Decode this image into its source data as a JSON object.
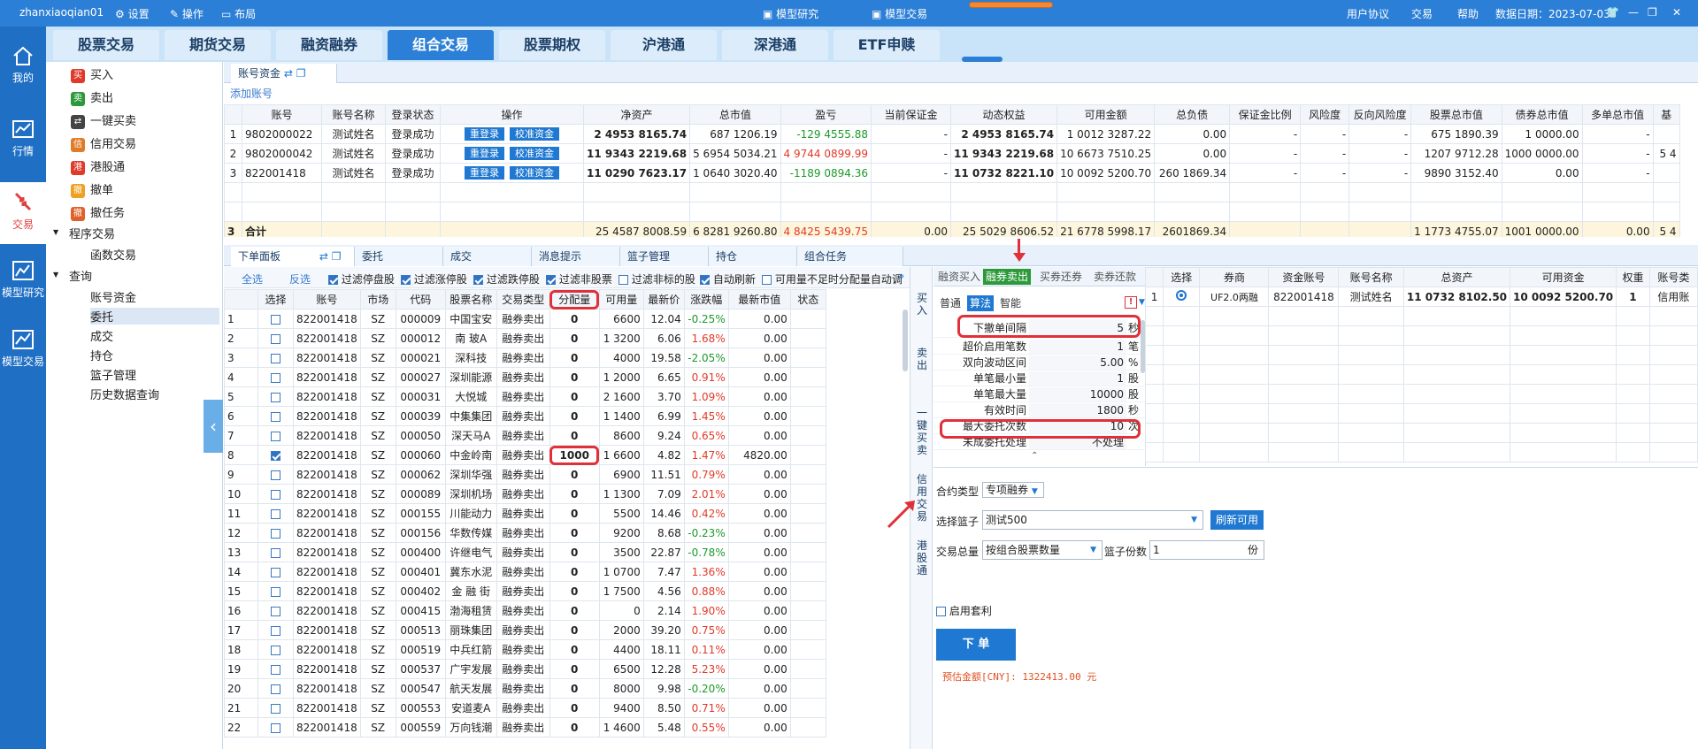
{
  "titlebar": {
    "user": "zhanxiaoqian01",
    "settings": "设置",
    "operation": "操作",
    "layout": "布局",
    "model_research": "模型研究",
    "model_trading": "模型交易",
    "agreement": "用户协议",
    "trade": "交易",
    "help": "帮助",
    "data_date": "数据日期：2023-07-03"
  },
  "leftnav": [
    {
      "label": "我的",
      "icon": "home-icon"
    },
    {
      "label": "行情",
      "icon": "chart-icon"
    },
    {
      "label": "交易",
      "icon": "trade-icon"
    },
    {
      "label": "模型研究",
      "icon": "model-research-icon"
    },
    {
      "label": "模型交易",
      "icon": "model-trade-icon"
    }
  ],
  "tabs": [
    "股票交易",
    "期货交易",
    "融资融券",
    "组合交易",
    "股票期权",
    "沪港通",
    "深港通",
    "ETF申赎"
  ],
  "tree": {
    "items": [
      {
        "icon": "买",
        "label": "买入",
        "color": "#e03a2a"
      },
      {
        "icon": "卖",
        "label": "卖出",
        "color": "#2c9a3a"
      },
      {
        "icon": "⇄",
        "label": "一键买卖",
        "color": "#444"
      },
      {
        "icon": "信",
        "label": "信用交易",
        "color": "#e07b2a"
      },
      {
        "icon": "港",
        "label": "港股通",
        "color": "#e03a2a"
      },
      {
        "icon": "撤",
        "label": "撤单",
        "color": "#f0a020"
      },
      {
        "icon": "撤",
        "label": "撤任务",
        "color": "#e0602a"
      }
    ],
    "program": "程序交易",
    "function_trade": "函数交易",
    "query": "查询",
    "query_items": [
      "账号资金",
      "委托",
      "成交",
      "持仓",
      "篮子管理",
      "历史数据查询"
    ]
  },
  "account": {
    "tab": "账号资金",
    "add": "添加账号",
    "headers": [
      "",
      "账号",
      "账号名称",
      "登录状态",
      "操作",
      "净资产",
      "总市值",
      "盈亏",
      "当前保证金",
      "动态权益",
      "可用金额",
      "总负债",
      "保证金比例",
      "风险度",
      "反向风险度",
      "股票总市值",
      "债券总市值",
      "多单总市值",
      "基"
    ],
    "relogin": "重登录",
    "verify": "校准资金",
    "rows": [
      [
        "1",
        "9802000022",
        "测试姓名",
        "登录成功",
        "",
        "2 4953 8165.74",
        "687 1206.19",
        "-129 4555.88",
        "-",
        "2 4953 8165.74",
        "1 0012 3287.22",
        "0.00",
        "-",
        "-",
        "-",
        "675 1890.39",
        "1 0000.00",
        "-",
        ""
      ],
      [
        "2",
        "9802000042",
        "测试姓名",
        "登录成功",
        "",
        "11 9343 2219.68",
        "5 6954 5034.21",
        "4 9744 0899.99",
        "-",
        "11 9343 2219.68",
        "10 6673 7510.25",
        "0.00",
        "-",
        "-",
        "-",
        "1207 9712.28",
        "1000 0000.00",
        "-",
        "5 4"
      ],
      [
        "3",
        "822001418",
        "测试姓名",
        "登录成功",
        "",
        "11 0290 7623.17",
        "1 0640 3020.40",
        "-1189 0894.36",
        "-",
        "11 0732 8221.10",
        "10 0092 5200.70",
        "260 1869.34",
        "-",
        "-",
        "-",
        "9890 3152.40",
        "0.00",
        "-",
        ""
      ]
    ],
    "total": [
      "3",
      "合计",
      "",
      "",
      "",
      "25 4587 8008.59",
      "6 8281 9260.80",
      "4 8425 5439.75",
      "0.00",
      "25 5029 8606.52",
      "21 6778 5998.17",
      "2601869.34",
      "",
      "",
      "",
      "1 1773 4755.07",
      "1001 0000.00",
      "0.00",
      "5 4"
    ]
  },
  "order_tabs": [
    "下单面板",
    "委托",
    "成交",
    "消息提示",
    "篮子管理",
    "持仓",
    "组合任务"
  ],
  "filters": {
    "select_all": "全选",
    "invert": "反选",
    "opts": [
      {
        "label": "过滤停盘股",
        "on": true
      },
      {
        "label": "过滤涨停股",
        "on": true
      },
      {
        "label": "过滤跌停股",
        "on": true
      },
      {
        "label": "过滤非股票",
        "on": true
      },
      {
        "label": "过滤非标的股",
        "on": false
      },
      {
        "label": "自动刷新",
        "on": true
      },
      {
        "label": "可用量不足时分配量自动调",
        "on": false
      }
    ]
  },
  "stock_table": {
    "headers": [
      "",
      "选择",
      "账号",
      "市场",
      "代码",
      "股票名称",
      "交易类型",
      "分配量",
      "可用量",
      "最新价",
      "涨跌幅",
      "最新市值",
      "状态"
    ],
    "rows": [
      [
        "1",
        false,
        "822001418",
        "SZ",
        "000009",
        "中国宝安",
        "融券卖出",
        "0",
        "6600",
        "12.04",
        "-0.25%",
        "0.00"
      ],
      [
        "2",
        false,
        "822001418",
        "SZ",
        "000012",
        "南 玻A",
        "融券卖出",
        "0",
        "1 3200",
        "6.06",
        "1.68%",
        "0.00"
      ],
      [
        "3",
        false,
        "822001418",
        "SZ",
        "000021",
        "深科技",
        "融券卖出",
        "0",
        "4000",
        "19.58",
        "-2.05%",
        "0.00"
      ],
      [
        "4",
        false,
        "822001418",
        "SZ",
        "000027",
        "深圳能源",
        "融券卖出",
        "0",
        "1 2000",
        "6.65",
        "0.91%",
        "0.00"
      ],
      [
        "5",
        false,
        "822001418",
        "SZ",
        "000031",
        "大悦城",
        "融券卖出",
        "0",
        "2 1600",
        "3.70",
        "1.09%",
        "0.00"
      ],
      [
        "6",
        false,
        "822001418",
        "SZ",
        "000039",
        "中集集团",
        "融券卖出",
        "0",
        "1 1400",
        "6.99",
        "1.45%",
        "0.00"
      ],
      [
        "7",
        false,
        "822001418",
        "SZ",
        "000050",
        "深天马A",
        "融券卖出",
        "0",
        "8600",
        "9.24",
        "0.65%",
        "0.00"
      ],
      [
        "8",
        true,
        "822001418",
        "SZ",
        "000060",
        "中金岭南",
        "融券卖出",
        "1000",
        "1 6600",
        "4.82",
        "1.47%",
        "4820.00"
      ],
      [
        "9",
        false,
        "822001418",
        "SZ",
        "000062",
        "深圳华强",
        "融券卖出",
        "0",
        "6900",
        "11.51",
        "0.79%",
        "0.00"
      ],
      [
        "10",
        false,
        "822001418",
        "SZ",
        "000089",
        "深圳机场",
        "融券卖出",
        "0",
        "1 1300",
        "7.09",
        "2.01%",
        "0.00"
      ],
      [
        "11",
        false,
        "822001418",
        "SZ",
        "000155",
        "川能动力",
        "融券卖出",
        "0",
        "5500",
        "14.46",
        "0.42%",
        "0.00"
      ],
      [
        "12",
        false,
        "822001418",
        "SZ",
        "000156",
        "华数传媒",
        "融券卖出",
        "0",
        "9200",
        "8.68",
        "-0.23%",
        "0.00"
      ],
      [
        "13",
        false,
        "822001418",
        "SZ",
        "000400",
        "许继电气",
        "融券卖出",
        "0",
        "3500",
        "22.87",
        "-0.78%",
        "0.00"
      ],
      [
        "14",
        false,
        "822001418",
        "SZ",
        "000401",
        "冀东水泥",
        "融券卖出",
        "0",
        "1 0700",
        "7.47",
        "1.36%",
        "0.00"
      ],
      [
        "15",
        false,
        "822001418",
        "SZ",
        "000402",
        "金 融 街",
        "融券卖出",
        "0",
        "1 7500",
        "4.56",
        "0.88%",
        "0.00"
      ],
      [
        "16",
        false,
        "822001418",
        "SZ",
        "000415",
        "渤海租赁",
        "融券卖出",
        "0",
        "0",
        "2.14",
        "1.90%",
        "0.00"
      ],
      [
        "17",
        false,
        "822001418",
        "SZ",
        "000513",
        "丽珠集团",
        "融券卖出",
        "0",
        "2000",
        "39.20",
        "0.75%",
        "0.00"
      ],
      [
        "18",
        false,
        "822001418",
        "SZ",
        "000519",
        "中兵红箭",
        "融券卖出",
        "0",
        "4400",
        "18.11",
        "0.11%",
        "0.00"
      ],
      [
        "19",
        false,
        "822001418",
        "SZ",
        "000537",
        "广宇发展",
        "融券卖出",
        "0",
        "6500",
        "12.28",
        "5.23%",
        "0.00"
      ],
      [
        "20",
        false,
        "822001418",
        "SZ",
        "000547",
        "航天发展",
        "融券卖出",
        "0",
        "8000",
        "9.98",
        "-0.20%",
        "0.00"
      ],
      [
        "21",
        false,
        "822001418",
        "SZ",
        "000553",
        "安道麦A",
        "融券卖出",
        "0",
        "9400",
        "8.50",
        "0.71%",
        "0.00"
      ],
      [
        "22",
        false,
        "822001418",
        "SZ",
        "000559",
        "万向钱潮",
        "融券卖出",
        "0",
        "1 4600",
        "5.48",
        "0.55%",
        "0.00"
      ]
    ]
  },
  "vtabs": [
    "买入",
    "卖出",
    "一键买卖",
    "信用交易",
    "港股通"
  ],
  "credit": {
    "tabs": [
      "融资买入",
      "融券卖出",
      "买券还券",
      "卖券还款"
    ],
    "modes": [
      "普通",
      "算法",
      "智能"
    ],
    "warn": "!",
    "params": [
      [
        "下撤单间隔",
        "5",
        "秒"
      ],
      [
        "超价启用笔数",
        "1",
        "笔"
      ],
      [
        "双向波动区间",
        "5.00",
        "%"
      ],
      [
        "单笔最小量",
        "1",
        "股"
      ],
      [
        "单笔最大量",
        "10000",
        "股"
      ],
      [
        "有效时间",
        "1800",
        "秒"
      ],
      [
        "最大委托次数",
        "10",
        "次"
      ],
      [
        "未成委托处理",
        "不处理",
        ""
      ]
    ],
    "contract_label": "合约类型",
    "contract_value": "专项融券",
    "basket_label": "选择篮子",
    "basket_value": "测试500",
    "refresh": "刷新可用",
    "total_label": "交易总量",
    "total_value": "按组合股票数量",
    "shares_label": "篮子份数",
    "shares_value": "1",
    "shares_unit": "份",
    "arb": "启用套利",
    "submit": "下 单",
    "estimate": "预估金额[CNY]: 1322413.00 元"
  },
  "acct_grid": {
    "headers": [
      "",
      "选择",
      "券商",
      "资金账号",
      "账号名称",
      "总资产",
      "可用资金",
      "权重",
      "账号类"
    ],
    "row": [
      "1",
      "",
      "UF2.0两融",
      "822001418",
      "测试姓名",
      "11 0732 8102.50",
      "10 0092 5200.70",
      "1",
      "信用账"
    ]
  },
  "colors": {
    "primary": "#2c7fd6",
    "highlight": "#e0303a",
    "positive": "#e03a2a",
    "negative": "#1c9a2a"
  }
}
